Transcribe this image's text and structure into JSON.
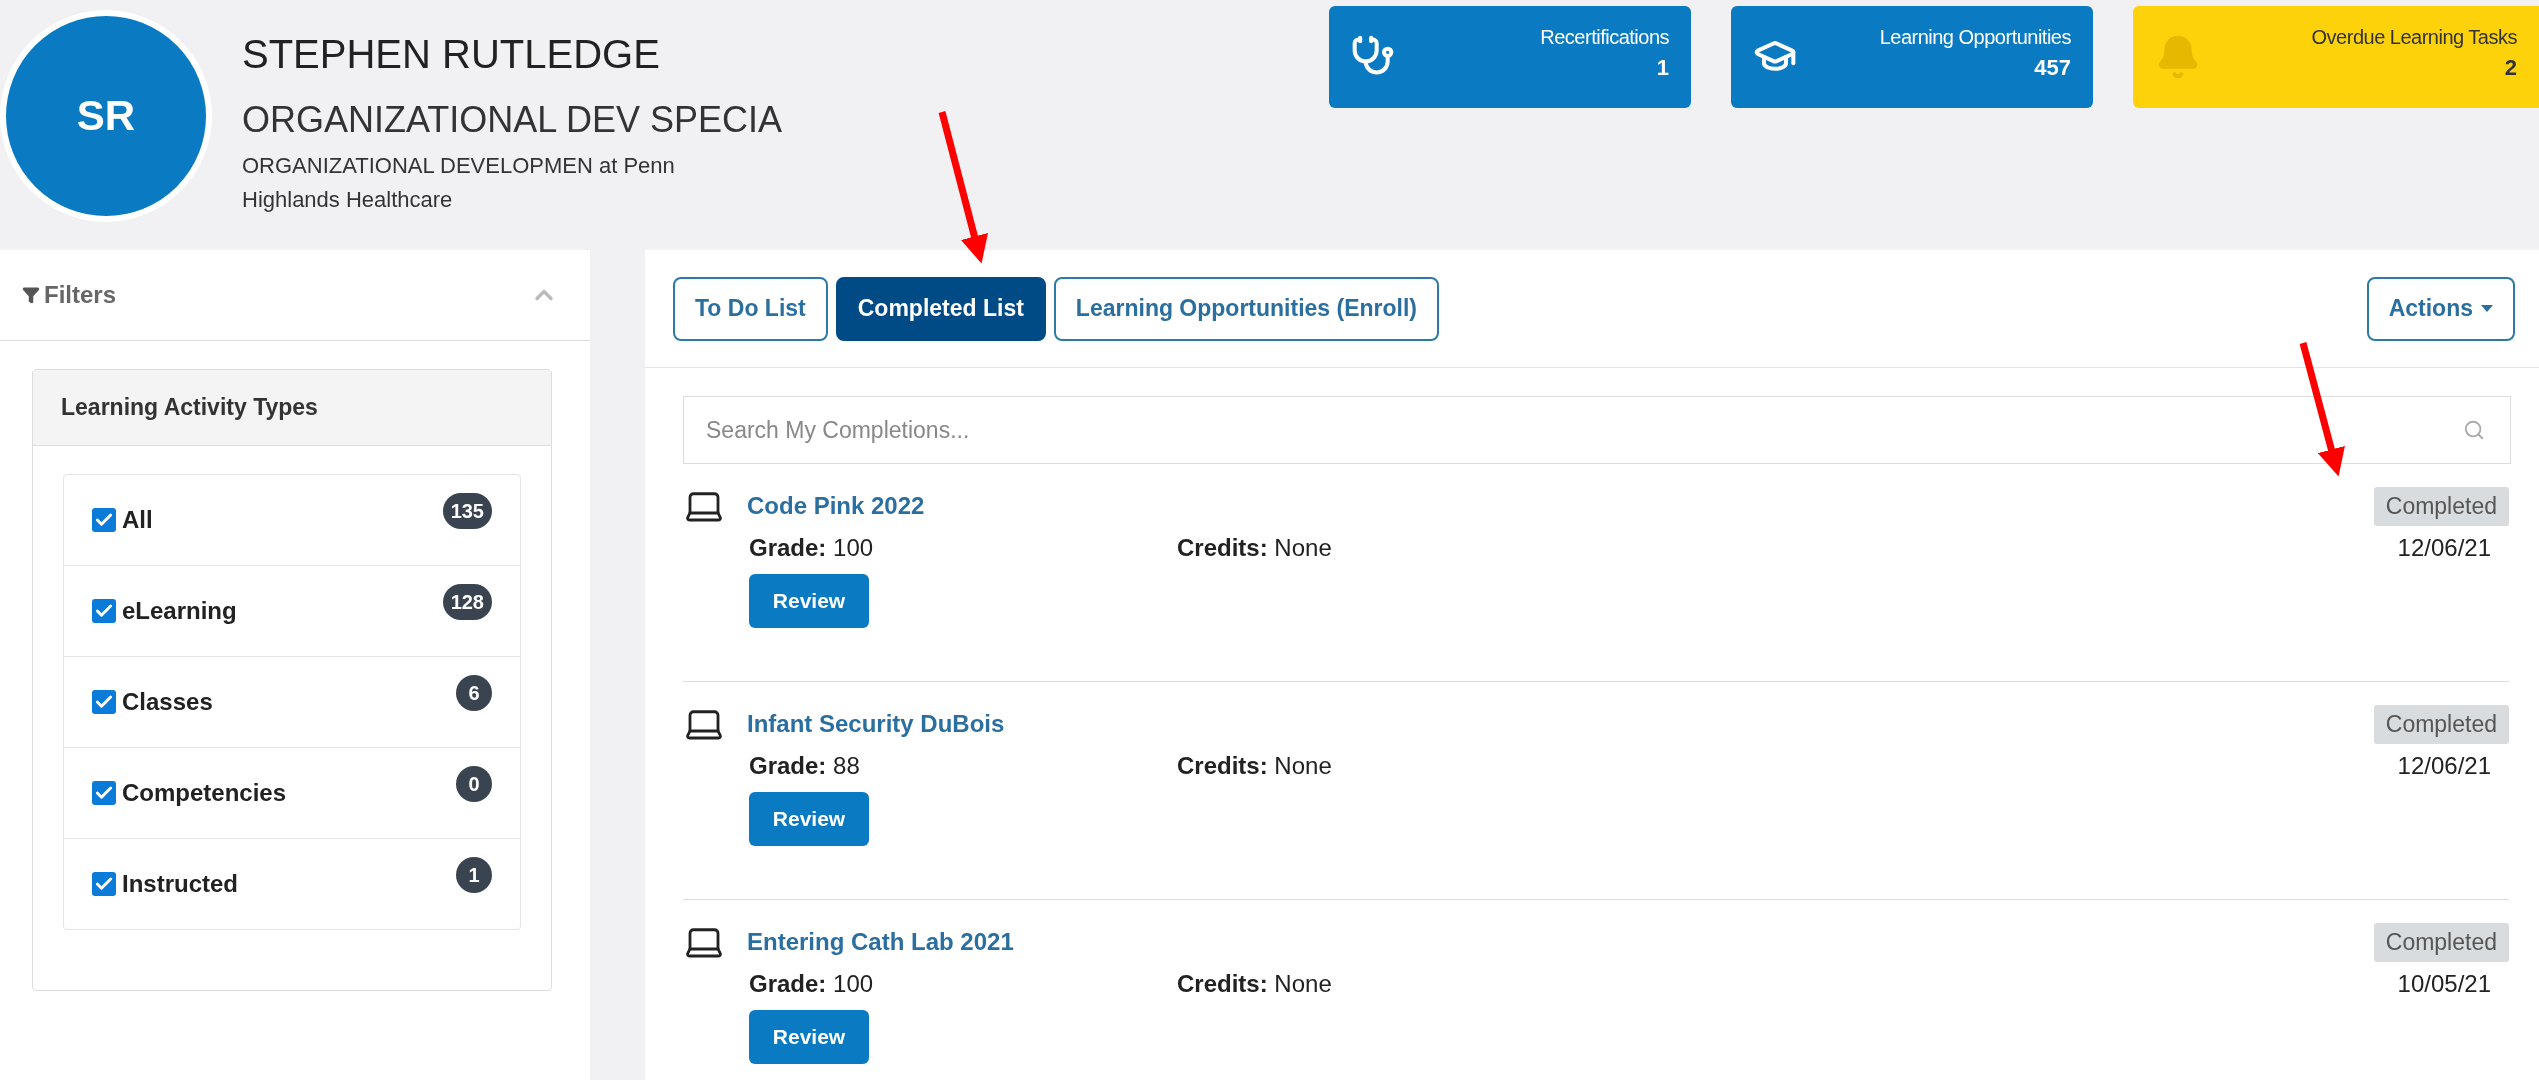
{
  "profile": {
    "initials": "SR",
    "name": "STEPHEN RUTLEDGE",
    "title": "ORGANIZATIONAL DEV SPECIA",
    "organization": "ORGANIZATIONAL DEVELOPMEN at Penn Highlands Healthcare"
  },
  "stat_cards": [
    {
      "kind": "stethoscope",
      "label": "Recertifications",
      "count": "1",
      "color": "#0a7bc2"
    },
    {
      "kind": "graduation-cap",
      "label": "Learning Opportunities",
      "count": "457",
      "color": "#0a7bc2"
    },
    {
      "kind": "bell",
      "label": "Overdue Learning Tasks",
      "count": "2",
      "color": "#fdd20a"
    }
  ],
  "filters": {
    "title": "Filters",
    "expanded": true,
    "section_title": "Learning Activity Types",
    "items": [
      {
        "label": "All",
        "checked": true,
        "count": "135"
      },
      {
        "label": "eLearning",
        "checked": true,
        "count": "128"
      },
      {
        "label": "Classes",
        "checked": true,
        "count": "6"
      },
      {
        "label": "Competencies",
        "checked": true,
        "count": "0"
      },
      {
        "label": "Instructed",
        "checked": true,
        "count": "1"
      }
    ]
  },
  "tabs": [
    {
      "label": "To Do List",
      "selected": false
    },
    {
      "label": "Completed List",
      "selected": true
    },
    {
      "label": "Learning Opportunities (Enroll)",
      "selected": false
    }
  ],
  "actions_button": {
    "label": "Actions"
  },
  "search": {
    "placeholder": "Search My Completions..."
  },
  "completions": [
    {
      "title": "Code Pink 2022",
      "grade_label": "Grade:",
      "grade": "100",
      "credits_label": "Credits:",
      "credits": "None",
      "button": "Review",
      "status": "Completed",
      "date": "12/06/21"
    },
    {
      "title": "Infant Security DuBois",
      "grade_label": "Grade:",
      "grade": "88",
      "credits_label": "Credits:",
      "credits": "None",
      "button": "Review",
      "status": "Completed",
      "date": "12/06/21"
    },
    {
      "title": "Entering Cath Lab 2021",
      "grade_label": "Grade:",
      "grade": "100",
      "credits_label": "Credits:",
      "credits": "None",
      "button": "Review",
      "status": "Completed",
      "date": "10/05/21"
    }
  ]
}
